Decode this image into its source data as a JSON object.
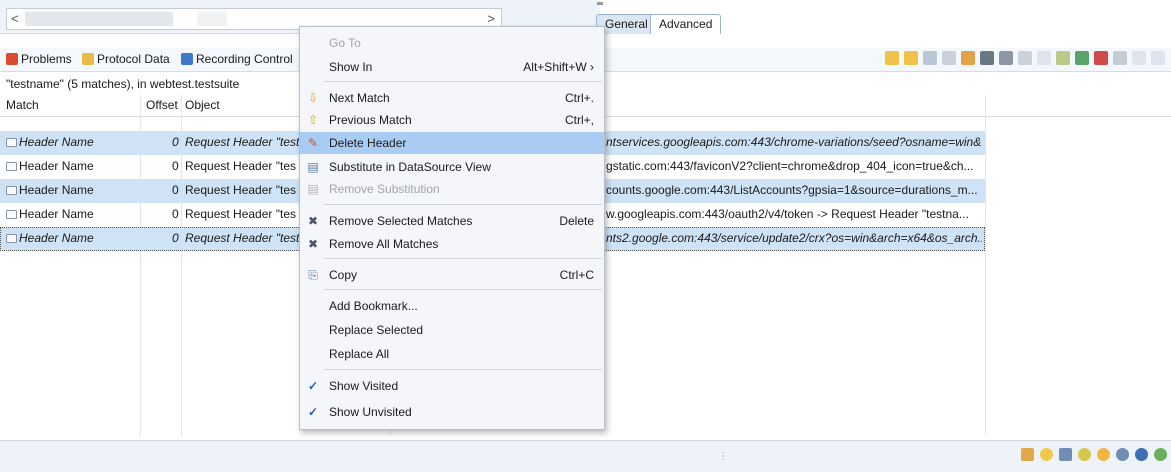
{
  "top": {
    "tabs": [
      "General",
      "Advanced"
    ]
  },
  "views": {
    "tabs": [
      {
        "label": "Problems",
        "icon": "problems-icon"
      },
      {
        "label": "Protocol Data",
        "icon": "protocol-data-icon"
      },
      {
        "label": "Recording Control",
        "icon": "recording-control-icon"
      }
    ]
  },
  "search": {
    "summary": "\"testname\" (5 matches), in webtest.testsuite",
    "columns": [
      "Match",
      "Offset",
      "Object"
    ],
    "rows": [
      {
        "match": "Header Name",
        "offset": "0",
        "object": "Request Header \"testn",
        "detail": "ntservices.googleapis.com:443/chrome-variations/seed?osname=win&...",
        "selected": true,
        "italic": true
      },
      {
        "match": "Header Name",
        "offset": "0",
        "object": "Request Header \"tes",
        "detail": "gstatic.com:443/faviconV2?client=chrome&drop_404_icon=true&ch...",
        "selected": false,
        "italic": false
      },
      {
        "match": "Header Name",
        "offset": "0",
        "object": "Request Header \"tes",
        "detail": "counts.google.com:443/ListAccounts?gpsia=1&source=durations_m...",
        "selected": true,
        "italic": false
      },
      {
        "match": "Header Name",
        "offset": "0",
        "object": "Request Header \"tes",
        "detail": "w.googleapis.com:443/oauth2/v4/token -> Request Header \"testna...",
        "selected": false,
        "italic": false
      },
      {
        "match": "Header Name",
        "offset": "0",
        "object": "Request Header \"testn",
        "detail": "nts2.google.com:443/service/update2/crx?os=win&arch=x64&os_arch...",
        "selected": true,
        "italic": true
      }
    ]
  },
  "menu": {
    "go_to": "Go To",
    "show_in": "Show In",
    "show_in_shortcut": "Alt+Shift+W",
    "next_match": "Next Match",
    "next_match_shortcut": "Ctrl+.",
    "previous_match": "Previous Match",
    "previous_match_shortcut": "Ctrl+,",
    "delete_header": "Delete Header",
    "substitute": "Substitute in DataSource View",
    "remove_substitution": "Remove Substitution",
    "remove_selected": "Remove Selected Matches",
    "remove_selected_shortcut": "Delete",
    "remove_all": "Remove All Matches",
    "copy": "Copy",
    "copy_shortcut": "Ctrl+C",
    "add_bookmark": "Add Bookmark...",
    "replace_selected": "Replace Selected",
    "replace_all": "Replace All",
    "show_visited": "Show Visited",
    "show_unvisited": "Show Unvisited"
  },
  "colors": {
    "highlight": "#a9cdf2",
    "row_selected": "#cfe3f7",
    "check": "#1f62b6"
  }
}
